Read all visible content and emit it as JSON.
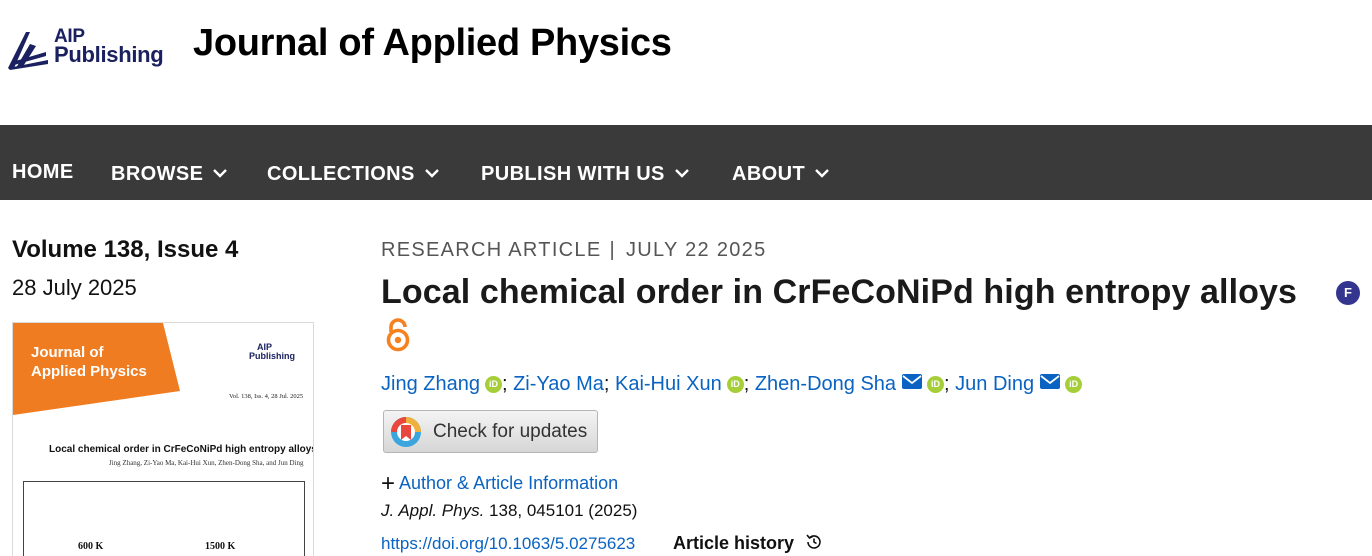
{
  "header": {
    "logo_line1": "AIP",
    "logo_line2": "Publishing",
    "journal_title": "Journal of Applied Physics"
  },
  "nav": {
    "items": [
      {
        "label": "HOME",
        "has_dropdown": false
      },
      {
        "label": "BROWSE",
        "has_dropdown": true
      },
      {
        "label": "COLLECTIONS",
        "has_dropdown": true
      },
      {
        "label": "PUBLISH WITH US",
        "has_dropdown": true
      },
      {
        "label": "ABOUT",
        "has_dropdown": true
      }
    ]
  },
  "issue": {
    "volume": "Volume 138, Issue 4",
    "date": "28 July 2025",
    "cover": {
      "journal_line1": "Journal of",
      "journal_line2": "Applied Physics",
      "logo_line1": "AIP",
      "logo_line2": "Publishing",
      "vol_text": "Vol. 138, Iss. 4, 28 Jul. 2025",
      "title": "Local chemical order in CrFeCoNiPd high entropy alloys",
      "authors": "Jing Zhang, Zi-Yao Ma, Kai-Hui Xun, Zhen-Dong Sha, and Jun Ding",
      "label_left": "600 K",
      "label_right": "1500 K"
    }
  },
  "article": {
    "type": "RESEARCH ARTICLE",
    "separator": "|",
    "date": "JULY 22 2025",
    "title": "Local chemical order in CrFeCoNiPd high entropy alloys",
    "featured_badge": "F",
    "authors": [
      {
        "name": "Jing Zhang",
        "orcid": true,
        "email": false
      },
      {
        "name": "Zi-Yao Ma",
        "orcid": false,
        "email": false
      },
      {
        "name": "Kai-Hui Xun",
        "orcid": true,
        "email": false
      },
      {
        "name": "Zhen-Dong Sha",
        "orcid": true,
        "email": true
      },
      {
        "name": "Jun Ding",
        "orcid": true,
        "email": true
      }
    ],
    "check_updates": "Check for updates",
    "author_info": "Author & Article Information",
    "citation_journal": "J. Appl. Phys.",
    "citation_rest": " 138, 045101 (2025)",
    "doi": "https://doi.org/10.1063/5.0275623",
    "article_history": "Article history"
  },
  "colors": {
    "nav_bg": "#3a3a3a",
    "link": "#0a63c2",
    "brand_navy": "#1b2160",
    "cover_orange": "#f07c22",
    "orcid_green": "#a6ce39",
    "featured_purple": "#33358f",
    "open_access_orange": "#f5821f"
  },
  "icons": [
    "aip-logo-icon",
    "chevron-down-icon",
    "featured-icon",
    "open-access-icon",
    "orcid-icon",
    "email-icon",
    "crossmark-icon",
    "plus-icon",
    "history-icon"
  ]
}
